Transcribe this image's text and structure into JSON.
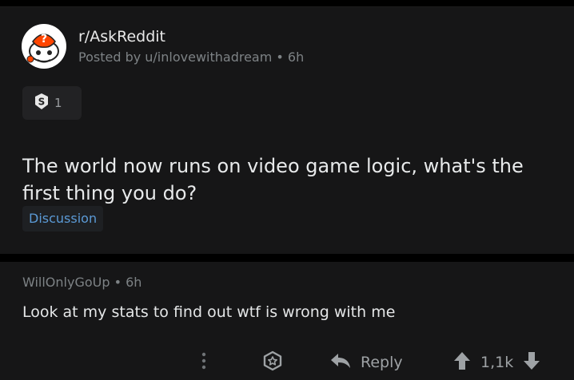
{
  "post": {
    "subreddit": "r/AskReddit",
    "posted_by": "Posted by u/inlovewithadream • 6h",
    "award_count": "1",
    "title": "The world now runs on video game logic, what's the first thing you do?",
    "flair": "Discussion"
  },
  "comment": {
    "meta": "WillOnlyGoUp • 6h",
    "body": "Look at my stats to find out wtf is wrong with me",
    "reply_label": "Reply",
    "score": "1,1k"
  },
  "icons": {
    "avatar": "askreddit-avatar-icon",
    "award": "silver-award-icon",
    "more": "more-vertical-icon",
    "give_award": "award-outline-icon",
    "reply": "reply-arrow-icon",
    "upvote": "upvote-arrow-icon",
    "downvote": "downvote-arrow-icon"
  },
  "colors": {
    "background": "#161617",
    "flair_text": "#5b9ad6",
    "meta_text": "#7d8285"
  }
}
